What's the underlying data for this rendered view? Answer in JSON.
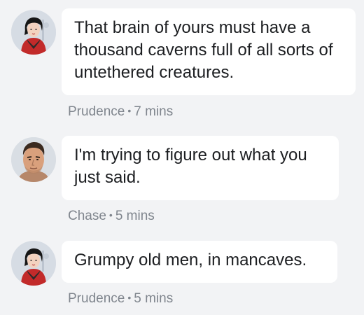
{
  "messages": [
    {
      "author": "Prudence",
      "avatar": "woman-avatar",
      "text": "That brain of yours must have a thousand caverns full of all sorts of untethered creatures.",
      "time": "7 mins"
    },
    {
      "author": "Chase",
      "avatar": "man-avatar",
      "text": "I'm trying to figure out what you just said.",
      "time": "5 mins"
    },
    {
      "author": "Prudence",
      "avatar": "woman-avatar",
      "text": "Grumpy old men, in mancaves.",
      "time": "5 mins"
    }
  ],
  "separator": "•",
  "colors": {
    "background": "#f2f3f5",
    "bubble": "#ffffff",
    "text": "#1c1e21",
    "meta": "#7f858d"
  }
}
